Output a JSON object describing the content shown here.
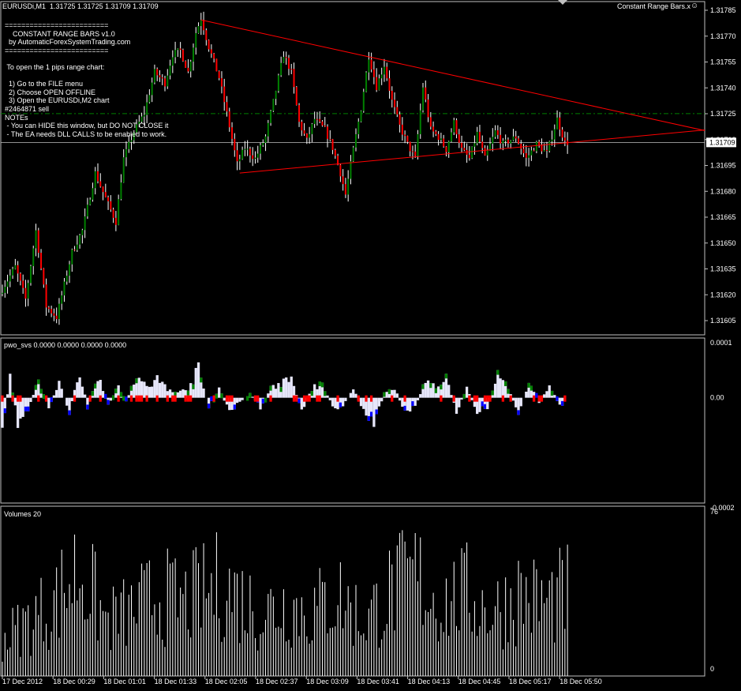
{
  "header": {
    "symbol_info": "EURUSDi,M1  1.31725 1.31725 1.31709 1.31709",
    "indicator_name": "Constant Range Bars.x",
    "smiley_icon": "smiley-icon"
  },
  "info_box": {
    "lines": [
      "=========================",
      "    CONSTANT RANGE BARS v1.0",
      "  by AutomaticForexSystemTrading.com",
      "=========================",
      "",
      " To open the 1 pips range chart:",
      "",
      "  1) Go to the FILE menu",
      "  2) Choose OPEN OFFLINE",
      "  3) Open the EURUSDi,M2 chart",
      "#2464871 sell",
      "NOTEs",
      " - You can HIDE this window, but DO NOT CLOSE it",
      " - The EA needs DLL CALLS to be enabled to work."
    ]
  },
  "colors": {
    "background": "#000000",
    "bull_candle": "#008000",
    "bear_candle": "#ff0000",
    "wick": "#ffffff",
    "trendline": "#ff0000",
    "order_line": "#008000",
    "bid_line": "#c0c0c0",
    "osc_fill": "#e6e6fa",
    "osc_pos_edge": "#008000",
    "osc_neg_edge": "#0000ff",
    "osc_red": "#ff0000",
    "volume": "#ffffff",
    "panel_border": "#c0c0c0"
  },
  "chart_data": [
    {
      "type": "candlestick",
      "title": "EURUSDi,M1",
      "ylim": [
        1.316,
        1.31785
      ],
      "y_ticks": [
        "1.31785",
        "1.31770",
        "1.31755",
        "1.31740",
        "1.31725",
        "1.31710",
        "1.31695",
        "1.31680",
        "1.31665",
        "1.31650",
        "1.31635",
        "1.31620",
        "1.31605"
      ],
      "current_price": "1.31709",
      "order_level": 1.31725,
      "order_label": "#2464871 sell",
      "trendlines": [
        {
          "name": "upper",
          "from": {
            "bar": 77,
            "price": 1.31777
          },
          "to": {
            "bar": 220,
            "price": 1.31732
          }
        },
        {
          "name": "lower",
          "from": {
            "bar": 92,
            "price": 1.31692
          },
          "to": {
            "bar": 220,
            "price": 1.31709
          }
        }
      ],
      "price_path": [
        [
          0,
          1.31625
        ],
        [
          6,
          1.3164
        ],
        [
          10,
          1.31622
        ],
        [
          14,
          1.3166
        ],
        [
          18,
          1.31618
        ],
        [
          22,
          1.31612
        ],
        [
          28,
          1.31648
        ],
        [
          32,
          1.3166
        ],
        [
          37,
          1.31692
        ],
        [
          41,
          1.31678
        ],
        [
          45,
          1.31665
        ],
        [
          48,
          1.317
        ],
        [
          52,
          1.31715
        ],
        [
          56,
          1.31725
        ],
        [
          60,
          1.31748
        ],
        [
          64,
          1.31742
        ],
        [
          67,
          1.31758
        ],
        [
          70,
          1.3176
        ],
        [
          73,
          1.31748
        ],
        [
          76,
          1.3177
        ],
        [
          78,
          1.31778
        ],
        [
          81,
          1.31762
        ],
        [
          85,
          1.31745
        ],
        [
          88,
          1.31725
        ],
        [
          92,
          1.31697
        ],
        [
          95,
          1.31706
        ],
        [
          99,
          1.317
        ],
        [
          103,
          1.31712
        ],
        [
          107,
          1.31738
        ],
        [
          110,
          1.31758
        ],
        [
          113,
          1.31748
        ],
        [
          116,
          1.3172
        ],
        [
          119,
          1.3171
        ],
        [
          122,
          1.31722
        ],
        [
          126,
          1.31716
        ],
        [
          129,
          1.31706
        ],
        [
          132,
          1.31692
        ],
        [
          134,
          1.3168
        ],
        [
          137,
          1.31705
        ],
        [
          140,
          1.31728
        ],
        [
          143,
          1.31757
        ],
        [
          146,
          1.3174
        ],
        [
          149,
          1.31752
        ],
        [
          152,
          1.31732
        ],
        [
          155,
          1.31718
        ],
        [
          158,
          1.31708
        ],
        [
          161,
          1.317
        ],
        [
          164,
          1.3174
        ],
        [
          167,
          1.31716
        ],
        [
          170,
          1.31712
        ],
        [
          173,
          1.31705
        ],
        [
          176,
          1.3172
        ],
        [
          179,
          1.31705
        ],
        [
          182,
          1.317
        ],
        [
          185,
          1.31714
        ],
        [
          188,
          1.317
        ],
        [
          192,
          1.31715
        ],
        [
          195,
          1.31708
        ],
        [
          200,
          1.31712
        ],
        [
          204,
          1.317
        ],
        [
          208,
          1.31708
        ],
        [
          212,
          1.31703
        ],
        [
          216,
          1.31722
        ],
        [
          219,
          1.31709
        ]
      ]
    },
    {
      "type": "area",
      "title": "pwo_svs 0.0000 0.0000 0.0000 0.0000",
      "ylim": [
        -0.0002,
        0.0001
      ],
      "y_ticks": [
        "0.0001",
        "0.00",
        "-0.0002"
      ],
      "peaks": [
        [
          0,
          -6e-05
        ],
        [
          3,
          4e-05
        ],
        [
          6,
          -5e-05
        ],
        [
          10,
          -3e-05
        ],
        [
          14,
          4e-05
        ],
        [
          18,
          -2e-05
        ],
        [
          22,
          3e-05
        ],
        [
          26,
          -3e-05
        ],
        [
          30,
          6e-05
        ],
        [
          33,
          -2e-05
        ],
        [
          37,
          5e-05
        ],
        [
          41,
          -2e-05
        ],
        [
          45,
          3e-05
        ],
        [
          48,
          -1e-05
        ],
        [
          52,
          5e-05
        ],
        [
          56,
          2e-05
        ],
        [
          60,
          4e-05
        ],
        [
          64,
          2e-05
        ],
        [
          68,
          1e-05
        ],
        [
          72,
          2e-05
        ],
        [
          76,
          6e-05
        ],
        [
          80,
          -2e-05
        ],
        [
          84,
          2e-05
        ],
        [
          88,
          -3e-05
        ],
        [
          92,
          -1e-05
        ],
        [
          96,
          1e-05
        ],
        [
          100,
          -2e-05
        ],
        [
          104,
          2e-05
        ],
        [
          108,
          3e-05
        ],
        [
          112,
          4e-05
        ],
        [
          116,
          -3e-05
        ],
        [
          120,
          2e-05
        ],
        [
          124,
          3e-05
        ],
        [
          128,
          -2e-05
        ],
        [
          132,
          -2e-05
        ],
        [
          136,
          2e-05
        ],
        [
          140,
          -3e-05
        ],
        [
          144,
          -6e-05
        ],
        [
          148,
          1e-05
        ],
        [
          152,
          2e-05
        ],
        [
          156,
          -3e-05
        ],
        [
          160,
          -2e-05
        ],
        [
          164,
          4e-05
        ],
        [
          168,
          2e-05
        ],
        [
          172,
          4e-05
        ],
        [
          176,
          -3e-05
        ],
        [
          180,
          2e-05
        ],
        [
          184,
          -3e-05
        ],
        [
          188,
          -2e-05
        ],
        [
          192,
          5e-05
        ],
        [
          196,
          2e-05
        ],
        [
          200,
          -3e-05
        ],
        [
          204,
          3e-05
        ],
        [
          208,
          -1e-05
        ],
        [
          212,
          3e-05
        ],
        [
          216,
          -2e-05
        ],
        [
          219,
          0.0
        ]
      ]
    },
    {
      "type": "bar",
      "title": "Volumes 20",
      "ylim": [
        0,
        76
      ],
      "y_ticks": [
        "76",
        "0"
      ],
      "peaks": [
        [
          0,
          20
        ],
        [
          10,
          30
        ],
        [
          20,
          40
        ],
        [
          30,
          60
        ],
        [
          40,
          30
        ],
        [
          50,
          35
        ],
        [
          60,
          45
        ],
        [
          70,
          40
        ],
        [
          85,
          50
        ],
        [
          100,
          35
        ],
        [
          110,
          40
        ],
        [
          120,
          35
        ],
        [
          130,
          45
        ],
        [
          140,
          30
        ],
        [
          150,
          45
        ],
        [
          160,
          55
        ],
        [
          170,
          40
        ],
        [
          180,
          45
        ],
        [
          190,
          35
        ],
        [
          200,
          45
        ],
        [
          210,
          40
        ],
        [
          219,
          45
        ]
      ]
    }
  ],
  "x_axis": {
    "labels": [
      "17 Dec 2012",
      "18 Dec 00:29",
      "18 Dec 01:01",
      "18 Dec 01:33",
      "18 Dec 02:05",
      "18 Dec 02:37",
      "18 Dec 03:09",
      "18 Dec 03:41",
      "18 Dec 04:13",
      "18 Dec 04:45",
      "18 Dec 05:17",
      "18 Dec 05:50"
    ]
  }
}
